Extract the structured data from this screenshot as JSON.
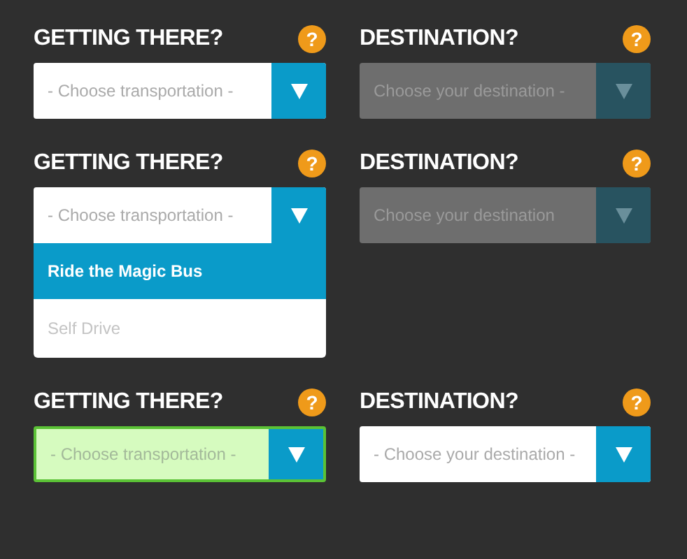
{
  "rows": [
    {
      "fields": [
        {
          "label": "GETTING THERE?",
          "help": "?",
          "prompt": "- Choose transportation -",
          "disabled": false,
          "valid": false
        },
        {
          "label": "DESTINATION?",
          "help": "?",
          "prompt": "Choose your destination -",
          "disabled": true,
          "valid": false
        }
      ]
    },
    {
      "fields": [
        {
          "label": "GETTING THERE?",
          "help": "?",
          "prompt": "- Choose transportation -",
          "disabled": false,
          "valid": false,
          "expanded": true,
          "options": [
            {
              "label": "Ride the Magic Bus",
              "selected": true
            },
            {
              "label": "Self Drive",
              "selected": false
            }
          ]
        },
        {
          "label": "DESTINATION?",
          "help": "?",
          "prompt": "Choose your destination",
          "disabled": true,
          "valid": false
        }
      ]
    },
    {
      "fields": [
        {
          "label": "GETTING THERE?",
          "help": "?",
          "prompt": "- Choose transportation -",
          "disabled": false,
          "valid": true
        },
        {
          "label": "DESTINATION?",
          "help": "?",
          "prompt": "- Choose your destination -",
          "disabled": false,
          "valid": false
        }
      ]
    }
  ]
}
